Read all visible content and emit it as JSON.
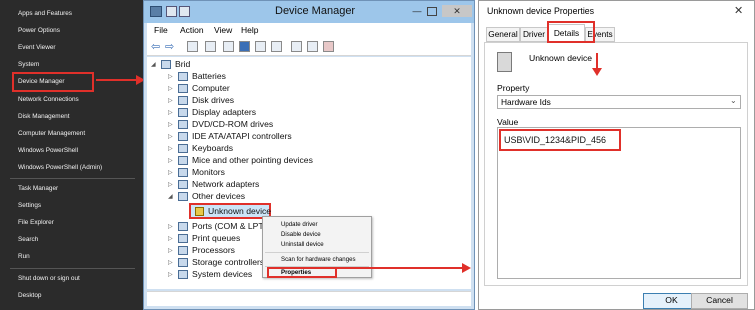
{
  "winx_menu": {
    "items": [
      "Apps and Features",
      "Power Options",
      "Event Viewer",
      "System",
      "Device Manager",
      "Network Connections",
      "Disk Management",
      "Computer Management",
      "Windows PowerShell",
      "Windows PowerShell (Admin)"
    ],
    "items2": [
      "Task Manager",
      "Settings",
      "File Explorer",
      "Search",
      "Run"
    ],
    "items3": [
      "Shut down or sign out",
      "Desktop"
    ]
  },
  "device_manager": {
    "title": "Device Manager",
    "menu": [
      "File",
      "Action",
      "View",
      "Help"
    ],
    "root": "Brid",
    "tree": [
      "Batteries",
      "Computer",
      "Disk drives",
      "Display adapters",
      "DVD/CD-ROM drives",
      "IDE ATA/ATAPI controllers",
      "Keyboards",
      "Mice and other pointing devices",
      "Monitors",
      "Network adapters",
      "Other devices"
    ],
    "unknown_device": "Unknown device",
    "tree_after": [
      "Ports (COM & LPT)",
      "Print queues",
      "Processors",
      "Storage controllers",
      "System devices"
    ],
    "context_menu": [
      "Update driver",
      "Disable device",
      "Uninstall device",
      "Scan for hardware changes",
      "Properties"
    ]
  },
  "properties": {
    "title": "Unknown device Properties",
    "tabs": [
      "General",
      "Driver",
      "Details",
      "Events"
    ],
    "device_name": "Unknown device",
    "property_label": "Property",
    "property_value": "Hardware Ids",
    "value_label": "Value",
    "value": "USB\\VID_1234&PID_456",
    "ok": "OK",
    "cancel": "Cancel"
  },
  "colors": {
    "accent_red": "#e0302a",
    "winx_bg": "#2b2b2b",
    "title_bar": "#9dc6ea"
  }
}
